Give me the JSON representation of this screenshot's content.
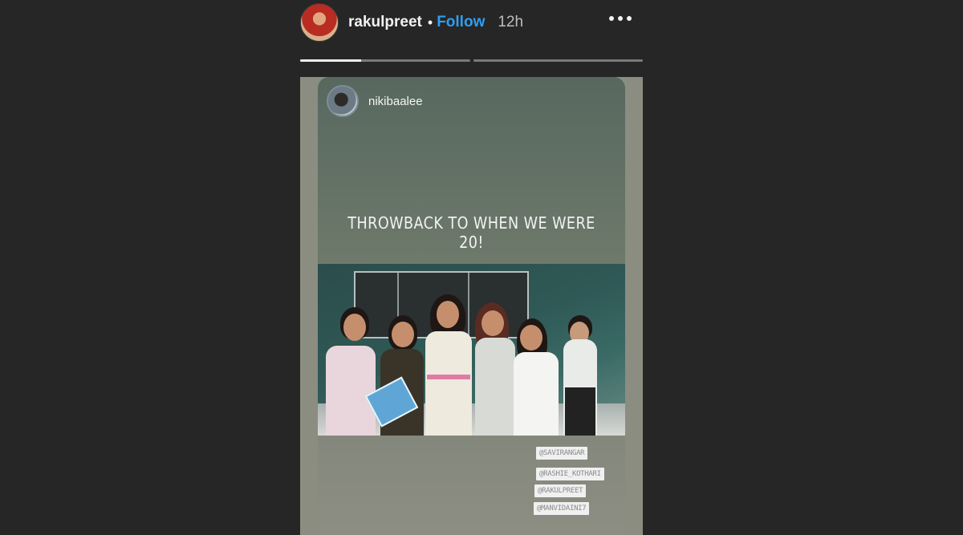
{
  "header": {
    "username": "rakulpreet",
    "separator": "•",
    "follow_label": "Follow",
    "time_ago": "12h",
    "more_icon": "more-horizontal-icon"
  },
  "progress": {
    "segments": [
      {
        "fill": 0.36
      },
      {
        "fill": 0
      }
    ]
  },
  "story": {
    "shared_post": {
      "username": "nikibaalee",
      "caption": "THROWBACK TO WHEN WE WERE 20!",
      "tags": [
        "@SAVIRANGAR",
        "@RASHIE_KOTHARI",
        "@RAKULPREET",
        "@MANVIDAINI7"
      ]
    }
  }
}
